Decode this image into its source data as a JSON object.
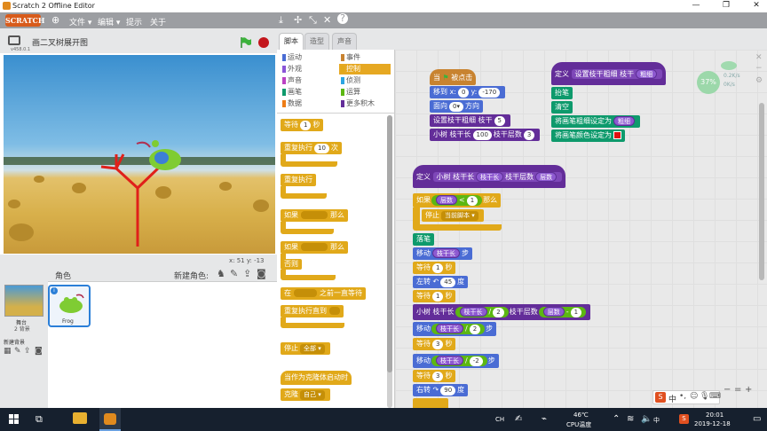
{
  "window": {
    "title": "Scratch 2 Offline Editor",
    "minimize": "—",
    "maximize": "❐",
    "close": "✕"
  },
  "menubar": {
    "logo": "SCRATCH",
    "file": "文件 ▾",
    "edit": "编辑 ▾",
    "tips": "提示",
    "about": "关于"
  },
  "stage": {
    "project_title": "画二叉树展开图",
    "version": "v458.0.1",
    "coords": "x: 51   y: -13"
  },
  "sprites": {
    "header": "角色",
    "new_sprite_label": "新建角色:",
    "stage_label": "舞台",
    "stage_backdrops": "2 背景",
    "new_backdrop": "新建背景",
    "sprite_name": "Frog"
  },
  "tabs": {
    "scripts": "脚本",
    "costumes": "造型",
    "sounds": "声音"
  },
  "categories": {
    "motion": "运动",
    "looks": "外观",
    "sound": "声音",
    "pen": "画笔",
    "data": "数据",
    "events": "事件",
    "control": "控制",
    "sensing": "侦测",
    "operators": "运算",
    "more": "更多积木"
  },
  "palette": {
    "wait": "等待",
    "wait_num": "1",
    "wait_unit": "秒",
    "repeat": "重复执行",
    "repeat_num": "10",
    "repeat_unit": "次",
    "forever": "重复执行",
    "if_then": "如果",
    "then": "那么",
    "if_else": "如果",
    "then2": "那么",
    "else": "否则",
    "wait_until": "在",
    "wait_until2": "之前一直等待",
    "repeat_until": "重复执行直到",
    "stop": "停止",
    "stop_opt": "全部 ▾",
    "clone_start": "当作为克隆体启动时",
    "clone": "克隆",
    "clone_opt": "自己 ▾"
  },
  "script1": {
    "when_flag": "当",
    "clicked": "被点击",
    "goto": "移到 x:",
    "x": "0",
    "y_label": "y:",
    "y": "-170",
    "point": "面向",
    "dir": "0▾",
    "dir_unit": "方向",
    "set_w": "设置枝干粗细 枝干",
    "w": "5",
    "call": "小树 枝干长",
    "len": "100",
    "levels_label": "枝干层数",
    "levels": "3"
  },
  "script2": {
    "define": "定义",
    "proc": "设置枝干粗细 枝干",
    "param": "粗细",
    "pen_down": "抬笔",
    "clear": "清空",
    "set_pen_size": "将画笔粗细设定为",
    "size_param": "粗细",
    "set_pen_color": "将画笔颜色设定为"
  },
  "script3": {
    "define": "定义",
    "proc": "小树 枝干长",
    "p1": "枝干长",
    "p2": "枝干层数",
    "p3": "层数",
    "if": "如果",
    "cmp_left": "层数",
    "lt": "<",
    "cmp_right": "1",
    "then": "那么",
    "stop": "停止",
    "stop_opt": "当前脚本 ▾",
    "pen_down": "落笔",
    "move1": "移动",
    "move1_p": "枝干长",
    "step": "步",
    "wait1": "等待",
    "wait1_n": "1",
    "sec": "秒",
    "turn_left": "左转",
    "turn_left_n": "45",
    "deg": "度",
    "wait2": "等待",
    "wait2_n": "1",
    "rec": "小树 枝干长",
    "rec_p1": "枝干长",
    "div": "/",
    "rec_n1": "2",
    "rec_lv": "枝干层数",
    "rec_p2": "层数",
    "minus": "-",
    "rec_n2": "1",
    "move2": "移动",
    "move2_p": "枝干长",
    "move2_div": "/",
    "move2_n": "2",
    "wait3": "等待",
    "wait3_n": "3",
    "move3": "移动",
    "move3_p": "枝干长",
    "move3_div": "/",
    "move3_n": "-2",
    "wait4": "等待",
    "wait4_n": "3",
    "turn_right": "右转",
    "turn_right_n": "90"
  },
  "overlay": {
    "percent": "37%",
    "speed1": "0.2K/s",
    "speed2": "0K/s"
  },
  "taskbar": {
    "ime": "中",
    "ch": "CH",
    "temp": "46℃",
    "cpu": "CPU温度",
    "time": "20:01",
    "date": "2019-12-18"
  },
  "zoom": {
    "out": "−",
    "reset": "=",
    "in": "+"
  },
  "colors": {
    "menubar": "#9c9ea2",
    "control": "#e1a91a",
    "motion": "#4a6cd4",
    "pen": "#0e9a6c",
    "more": "#632d99",
    "events": "#c88330",
    "operators": "#5cb712"
  }
}
